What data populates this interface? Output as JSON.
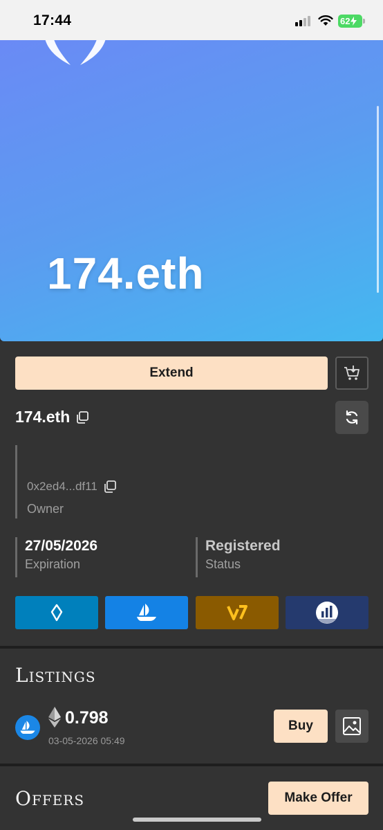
{
  "status_bar": {
    "time": "17:44",
    "battery": "62"
  },
  "hero": {
    "name": "174.eth"
  },
  "actions": {
    "extend_label": "Extend"
  },
  "name_header": {
    "title": "174.eth"
  },
  "owner": {
    "address": "0x2ed4...df11",
    "label": "Owner"
  },
  "expiration": {
    "value": "27/05/2026",
    "label": "Expiration"
  },
  "status": {
    "value": "Registered",
    "label": "Status"
  },
  "marketplaces": [
    {
      "icon": "ens-icon",
      "color": "#0080bc"
    },
    {
      "icon": "opensea-icon",
      "color": "#1482e5"
    },
    {
      "icon": "vision-icon",
      "color": "#8a5a00"
    },
    {
      "icon": "analytics-icon",
      "color": "#253a6e"
    }
  ],
  "listings": {
    "title": "Listings",
    "items": [
      {
        "price": "0.798",
        "timestamp": "03-05-2026 05:49",
        "buy_label": "Buy"
      }
    ]
  },
  "offers": {
    "title": "Offers",
    "make_offer_label": "Make Offer"
  },
  "colors": {
    "accent": "#fde0c4",
    "panel": "#333333",
    "hero_start": "#6a8af5",
    "hero_end": "#44b8f0"
  }
}
